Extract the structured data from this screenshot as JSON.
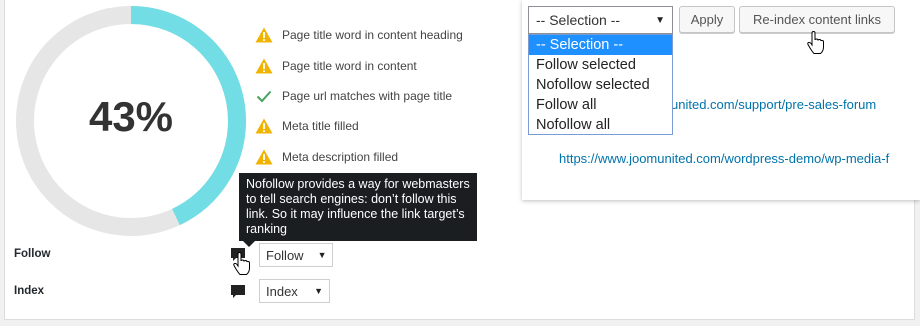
{
  "score": {
    "percent_label": "43%",
    "value": 43,
    "ring_color": "#72dde5",
    "track_color": "#e6e6e6"
  },
  "checks": [
    {
      "label": "Page title word in content heading",
      "status": "warning",
      "icon": "warning-icon"
    },
    {
      "label": "Page title word in content",
      "status": "warning",
      "icon": "warning-icon"
    },
    {
      "label": "Page url matches with page title",
      "status": "ok",
      "icon": "check-icon"
    },
    {
      "label": "Meta title filled",
      "status": "warning",
      "icon": "warning-icon"
    },
    {
      "label": "Meta description filled",
      "status": "warning",
      "icon": "warning-icon"
    }
  ],
  "tooltip": {
    "text": "Nofollow provides a way for webmasters to tell search engines: don’t follow this link. So it may influence the link target’s ranking"
  },
  "follow": {
    "label": "Follow",
    "value": "Follow"
  },
  "index": {
    "label": "Index",
    "value": "Index"
  },
  "links": {
    "url1": "https://www.joomunited.com/support/pre-sales-forum",
    "url1_visible": "united.com/support/pre-sales-forum",
    "url2": "https://www.joomunited.com/wordpress-demo/wp-media-f"
  },
  "bulk": {
    "selected": "-- Selection --",
    "options": [
      "-- Selection --",
      "Follow selected",
      "Nofollow selected",
      "Follow all",
      "Nofollow all"
    ],
    "apply_label": "Apply",
    "reindex_label": "Re-index content links"
  },
  "colors": {
    "warning": "#f0b400",
    "ok": "#46a35e",
    "link": "#0073aa",
    "tooltip_bg": "#1b1e21",
    "highlight": "#1e90ff"
  }
}
